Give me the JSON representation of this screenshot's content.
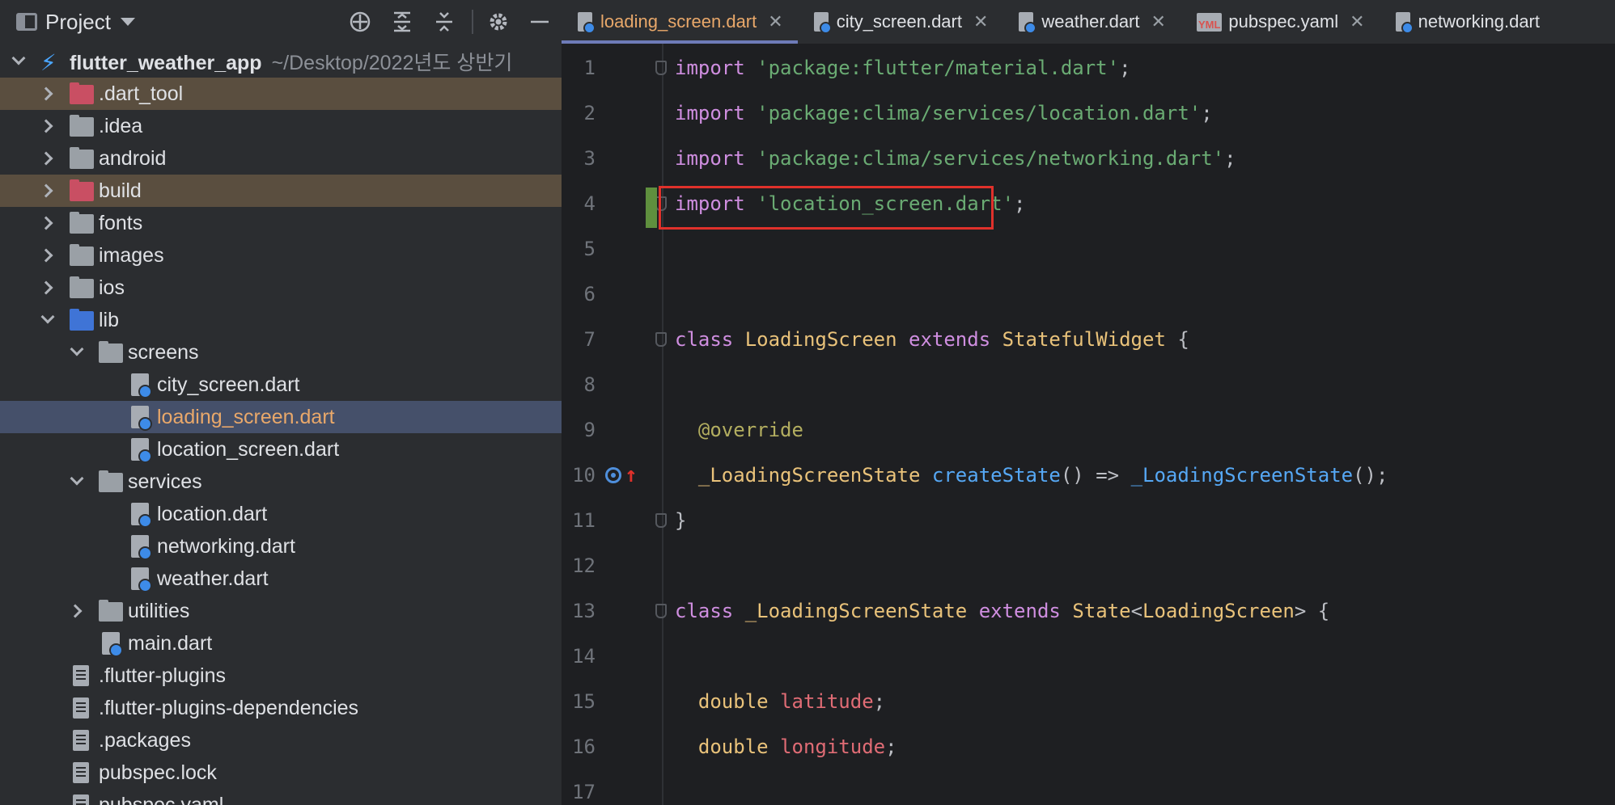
{
  "project_panel": {
    "title": "Project",
    "tools": [
      "crosshair-icon",
      "expand-all-icon",
      "collapse-all-icon",
      "gear-icon",
      "minimize-icon"
    ],
    "root": {
      "name": "flutter_weather_app",
      "path": "~/Desktop/2022년도 상반기"
    },
    "items": [
      {
        "label": ".dart_tool",
        "level": 1,
        "kind": "folder-excluded",
        "state": "collapsed"
      },
      {
        "label": ".idea",
        "level": 1,
        "kind": "folder-config",
        "state": "collapsed"
      },
      {
        "label": "android",
        "level": 1,
        "kind": "folder-module",
        "state": "collapsed"
      },
      {
        "label": "build",
        "level": 1,
        "kind": "folder-excluded",
        "state": "collapsed"
      },
      {
        "label": "fonts",
        "level": 1,
        "kind": "folder",
        "state": "collapsed"
      },
      {
        "label": "images",
        "level": 1,
        "kind": "folder",
        "state": "collapsed"
      },
      {
        "label": "ios",
        "level": 1,
        "kind": "folder-module",
        "state": "collapsed"
      },
      {
        "label": "lib",
        "level": 1,
        "kind": "folder-source",
        "state": "expanded"
      },
      {
        "label": "screens",
        "level": 2,
        "kind": "folder",
        "state": "expanded"
      },
      {
        "label": "city_screen.dart",
        "level": 3,
        "kind": "dart"
      },
      {
        "label": "loading_screen.dart",
        "level": 3,
        "kind": "dart",
        "selected": true
      },
      {
        "label": "location_screen.dart",
        "level": 3,
        "kind": "dart"
      },
      {
        "label": "services",
        "level": 2,
        "kind": "folder",
        "state": "expanded"
      },
      {
        "label": "location.dart",
        "level": 3,
        "kind": "dart"
      },
      {
        "label": "networking.dart",
        "level": 3,
        "kind": "dart"
      },
      {
        "label": "weather.dart",
        "level": 3,
        "kind": "dart"
      },
      {
        "label": "utilities",
        "level": 2,
        "kind": "folder",
        "state": "collapsed"
      },
      {
        "label": "main.dart",
        "level": 2,
        "kind": "dart"
      },
      {
        "label": ".flutter-plugins",
        "level": 1,
        "kind": "text"
      },
      {
        "label": ".flutter-plugins-dependencies",
        "level": 1,
        "kind": "text"
      },
      {
        "label": ".packages",
        "level": 1,
        "kind": "text"
      },
      {
        "label": "pubspec.lock",
        "level": 1,
        "kind": "text"
      },
      {
        "label": "pubspec.yaml",
        "level": 1,
        "kind": "yaml"
      }
    ]
  },
  "editor": {
    "tabs": [
      {
        "label": "loading_screen.dart",
        "active": true,
        "icon": "dart"
      },
      {
        "label": "city_screen.dart",
        "active": false,
        "icon": "dart"
      },
      {
        "label": "weather.dart",
        "active": false,
        "icon": "dart"
      },
      {
        "label": "pubspec.yaml",
        "active": false,
        "icon": "yaml"
      },
      {
        "label": "networking.dart",
        "active": false,
        "icon": "dart"
      }
    ],
    "close_glyph": "✕",
    "yml_badge": "YML",
    "lines": [
      {
        "n": "1",
        "tokens": [
          [
            "kw",
            "import"
          ],
          [
            "plain",
            " "
          ],
          [
            "str",
            "'package:flutter/material.dart'"
          ],
          [
            "plain",
            ";"
          ]
        ]
      },
      {
        "n": "2",
        "tokens": [
          [
            "kw",
            "import"
          ],
          [
            "plain",
            " "
          ],
          [
            "str",
            "'package:clima/services/location.dart'"
          ],
          [
            "plain",
            ";"
          ]
        ]
      },
      {
        "n": "3",
        "tokens": [
          [
            "kw",
            "import"
          ],
          [
            "plain",
            " "
          ],
          [
            "str",
            "'package:clima/services/networking.dart'"
          ],
          [
            "plain",
            ";"
          ]
        ]
      },
      {
        "n": "4",
        "tokens": [
          [
            "kw",
            "import"
          ],
          [
            "plain",
            " "
          ],
          [
            "str",
            "'location_screen.dart'"
          ],
          [
            "plain",
            ";"
          ]
        ]
      },
      {
        "n": "5",
        "tokens": []
      },
      {
        "n": "6",
        "tokens": []
      },
      {
        "n": "7",
        "tokens": [
          [
            "kw",
            "class"
          ],
          [
            "plain",
            " "
          ],
          [
            "ty",
            "LoadingScreen"
          ],
          [
            "plain",
            " "
          ],
          [
            "kw",
            "extends"
          ],
          [
            "plain",
            " "
          ],
          [
            "ty",
            "StatefulWidget"
          ],
          [
            "plain",
            " {"
          ]
        ]
      },
      {
        "n": "8",
        "tokens": []
      },
      {
        "n": "9",
        "tokens": [
          [
            "plain",
            "  "
          ],
          [
            "ann",
            "@override"
          ]
        ]
      },
      {
        "n": "10",
        "tokens": [
          [
            "plain",
            "  "
          ],
          [
            "ty",
            "_LoadingScreenState"
          ],
          [
            "plain",
            " "
          ],
          [
            "fn",
            "createState"
          ],
          [
            "plain",
            "() => "
          ],
          [
            "fn",
            "_LoadingScreenState"
          ],
          [
            "plain",
            "();"
          ]
        ]
      },
      {
        "n": "11",
        "tokens": [
          [
            "plain",
            "}"
          ]
        ]
      },
      {
        "n": "12",
        "tokens": []
      },
      {
        "n": "13",
        "tokens": [
          [
            "kw",
            "class"
          ],
          [
            "plain",
            " "
          ],
          [
            "ty",
            "_LoadingScreenState"
          ],
          [
            "plain",
            " "
          ],
          [
            "kw",
            "extends"
          ],
          [
            "plain",
            " "
          ],
          [
            "ty",
            "State"
          ],
          [
            "plain",
            "<"
          ],
          [
            "ty",
            "LoadingScreen"
          ],
          [
            "plain",
            "> {"
          ]
        ]
      },
      {
        "n": "14",
        "tokens": []
      },
      {
        "n": "15",
        "tokens": [
          [
            "plain",
            "  "
          ],
          [
            "ty",
            "double"
          ],
          [
            "plain",
            " "
          ],
          [
            "fld",
            "latitude"
          ],
          [
            "plain",
            ";"
          ]
        ]
      },
      {
        "n": "16",
        "tokens": [
          [
            "plain",
            "  "
          ],
          [
            "ty",
            "double"
          ],
          [
            "plain",
            " "
          ],
          [
            "fld",
            "longitude"
          ],
          [
            "plain",
            ";"
          ]
        ]
      },
      {
        "n": "17",
        "tokens": []
      }
    ]
  }
}
